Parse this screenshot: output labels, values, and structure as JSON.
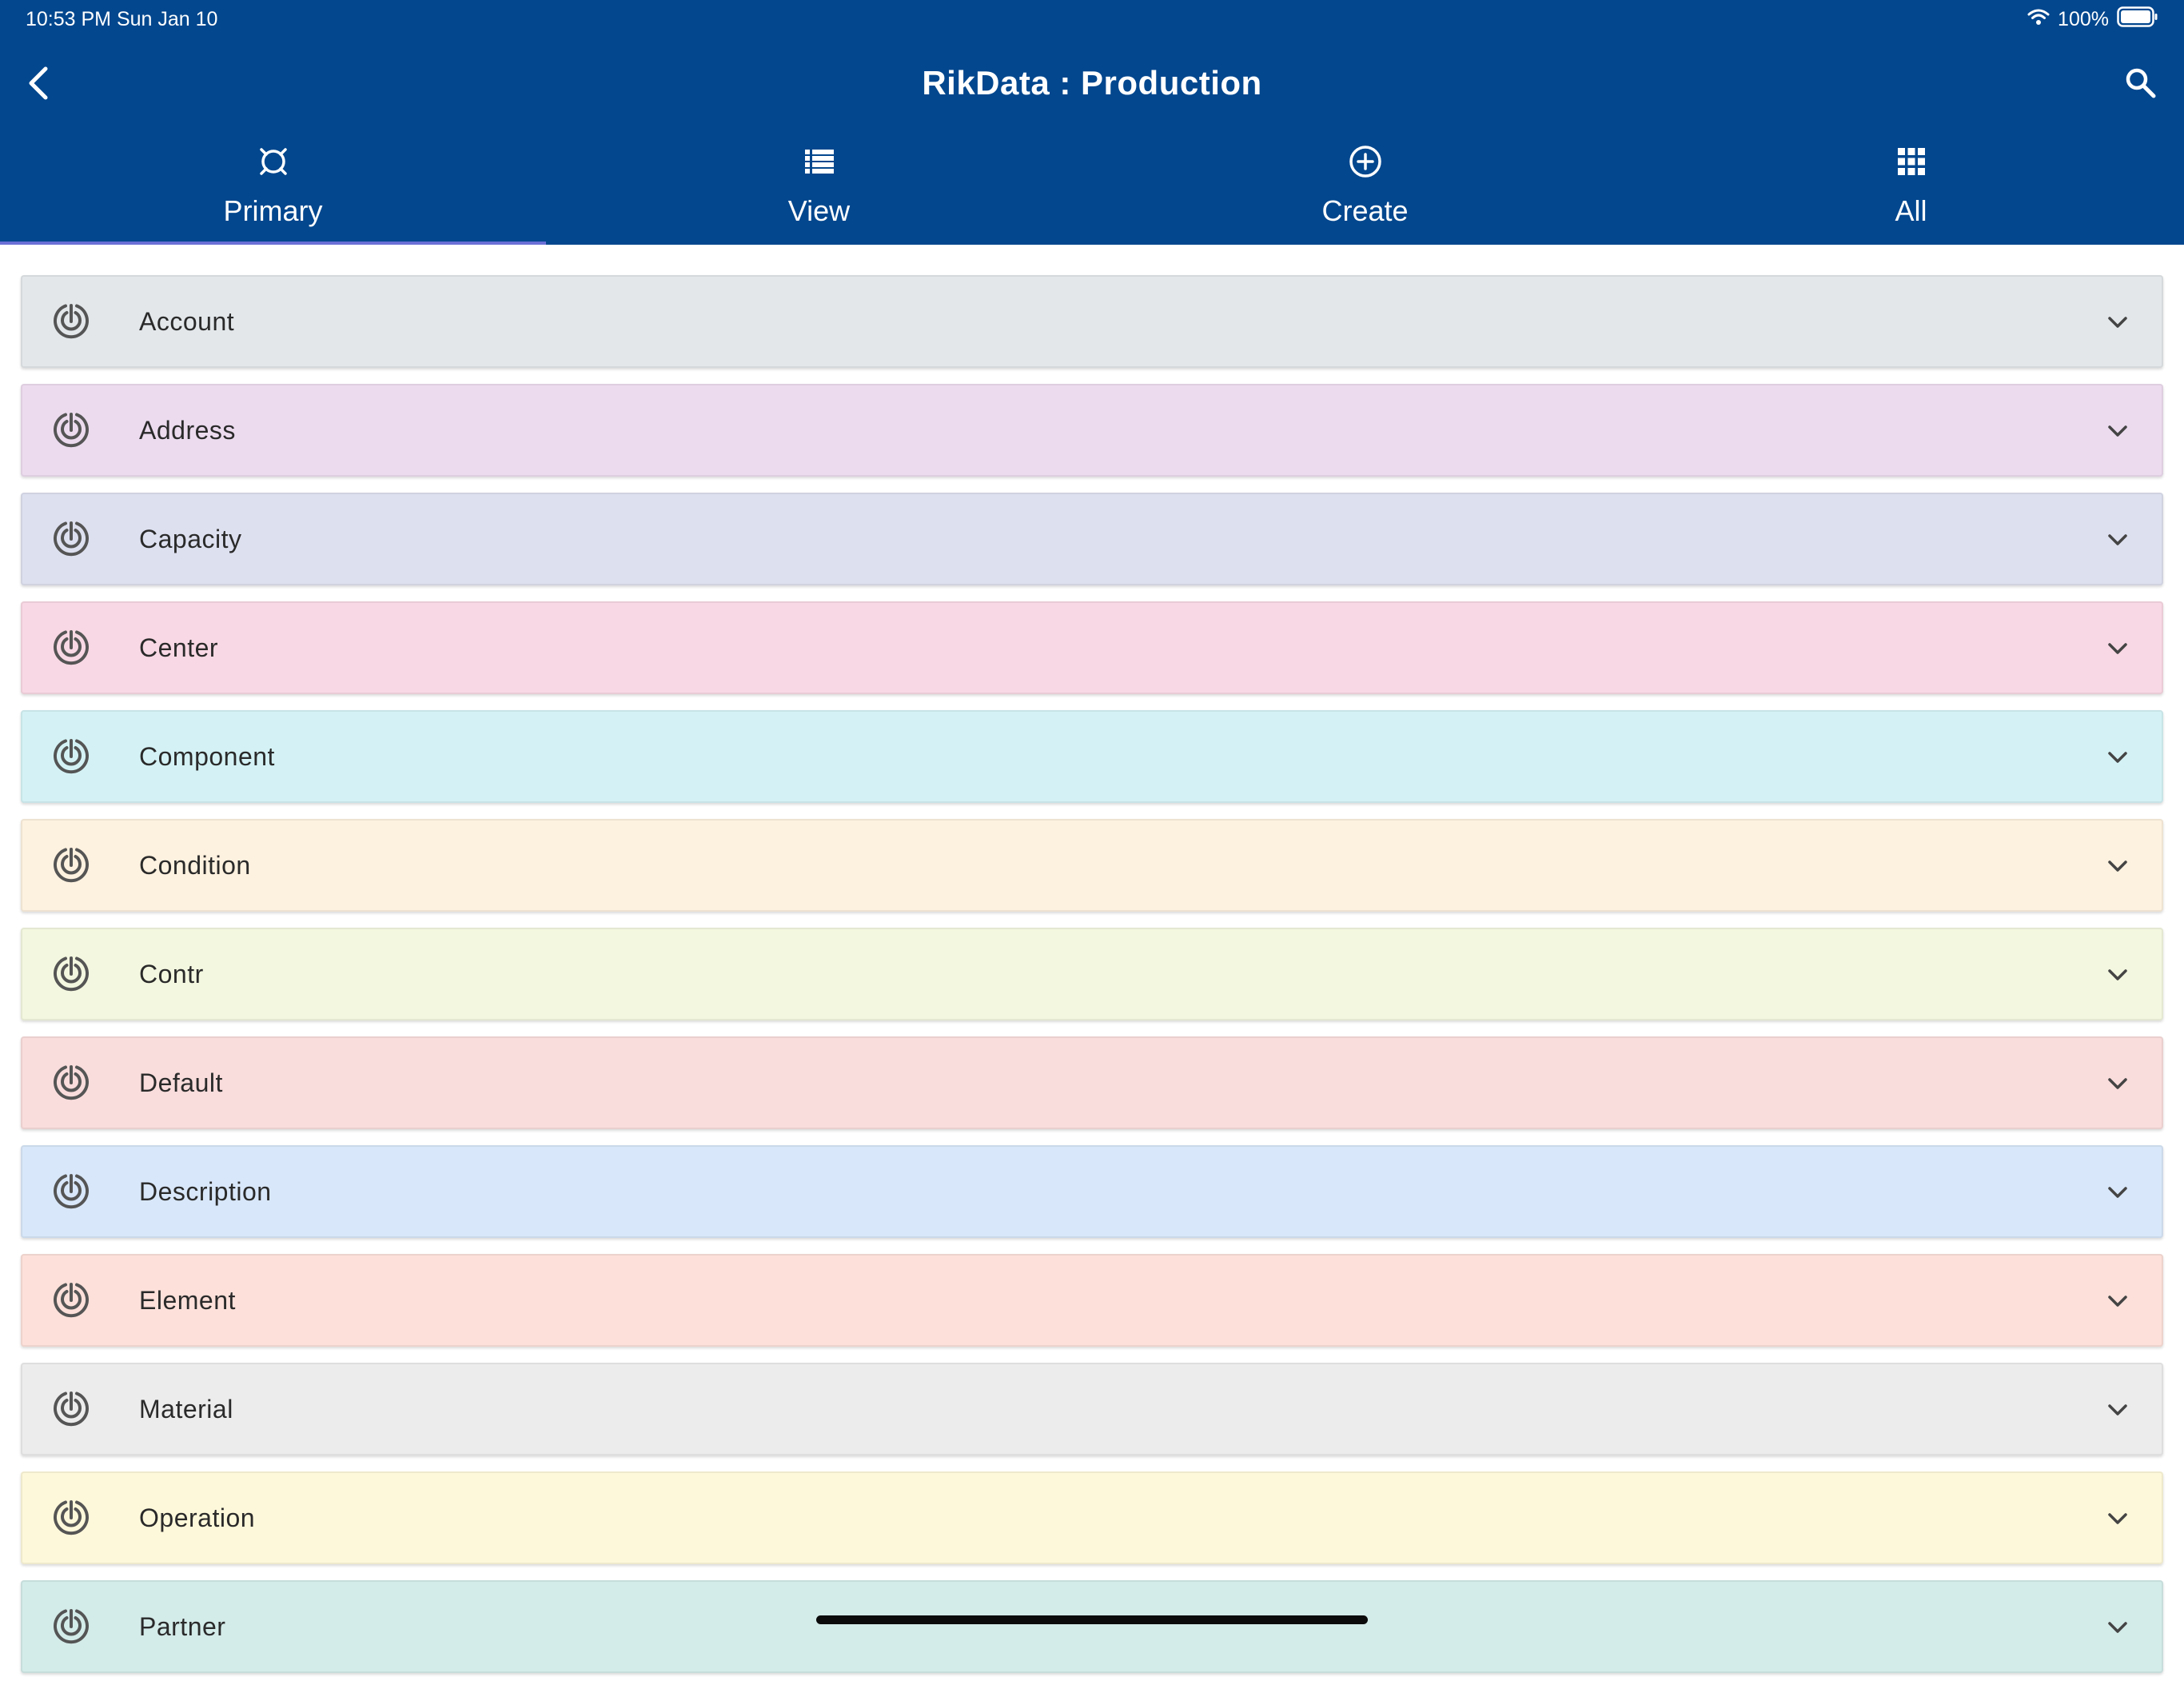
{
  "status_bar": {
    "time": "10:53 PM   Sun Jan 10",
    "battery": "100%"
  },
  "nav": {
    "title": "RikData : Production"
  },
  "tabs": [
    {
      "label": "Primary",
      "icon": "target-icon",
      "active": true
    },
    {
      "label": "View",
      "icon": "list-icon",
      "active": false
    },
    {
      "label": "Create",
      "icon": "plus-circle-icon",
      "active": false
    },
    {
      "label": "All",
      "icon": "grid-icon",
      "active": false
    }
  ],
  "rows": [
    {
      "label": "Account",
      "color": "#e3e7ea"
    },
    {
      "label": "Address",
      "color": "#ecdbef"
    },
    {
      "label": "Capacity",
      "color": "#dde0ef"
    },
    {
      "label": "Center",
      "color": "#f8d8e4"
    },
    {
      "label": "Component",
      "color": "#d4f2f5"
    },
    {
      "label": "Condition",
      "color": "#fdf1df"
    },
    {
      "label": "Contr",
      "color": "#f3f7df"
    },
    {
      "label": "Default",
      "color": "#f9dcdc"
    },
    {
      "label": "Description",
      "color": "#d8e7f9"
    },
    {
      "label": "Element",
      "color": "#fce0d9"
    },
    {
      "label": "Material",
      "color": "#ececec"
    },
    {
      "label": "Operation",
      "color": "#fef8da"
    },
    {
      "label": "Partner",
      "color": "#d3ebe9"
    }
  ]
}
